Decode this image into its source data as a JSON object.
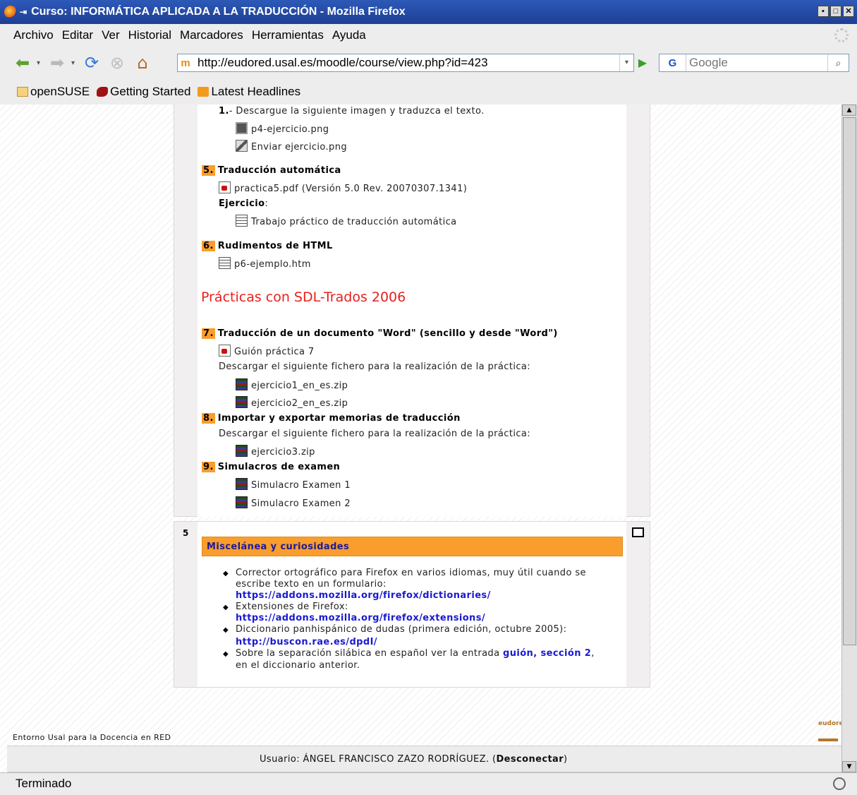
{
  "window": {
    "title": "Curso: INFORMÁTICA APLICADA A LA TRADUCCIÓN - Mozilla Firefox",
    "pin_glyph": "⇥",
    "buttons": [
      "▪",
      "□",
      "✕"
    ]
  },
  "menu": [
    "Archivo",
    "Editar",
    "Ver",
    "Historial",
    "Marcadores",
    "Herramientas",
    "Ayuda"
  ],
  "navigation": {
    "url": "http://eudored.usal.es/moodle/course/view.php?id=423",
    "search_placeholder": "Google",
    "search_engine_glyph": "G"
  },
  "bookmarks": [
    "openSUSE",
    "Getting Started",
    "Latest Headlines"
  ],
  "course": {
    "top_items": {
      "step1_num": "1.",
      "step1_text": "- Descargue la siguiente imagen y traduzca el texto.",
      "file_img": "p4-ejercicio.png",
      "file_send": "Enviar ejercicio.png"
    },
    "topic5": {
      "num": "5.",
      "title": "Traducción automática",
      "pdf": "practica5.pdf (Versión 5.0 Rev. 20070307.1341)",
      "exercise_label": "Ejercicio",
      "exercise_colon": ":",
      "exercise_doc": "Trabajo práctico de traducción automática"
    },
    "topic6": {
      "num": "6.",
      "title": "Rudimentos de HTML",
      "file": "p6-ejemplo.htm"
    },
    "trados_heading": "Prácticas con SDL-Trados 2006",
    "topic7": {
      "num": "7.",
      "title": "Traducción de un documento \"Word\" (sencillo y desde \"Word\")",
      "guide": "Guión práctica 7",
      "download_note": "Descargar el siguiente fichero para la realización de la práctica:",
      "zip1": "ejercicio1_en_es.zip",
      "zip2": "ejercicio2_en_es.zip"
    },
    "topic8": {
      "num": "8.",
      "title": "Importar y exportar memorias de traducción",
      "download_note": "Descargar el siguiente fichero para la realización de la práctica:",
      "zip": "ejercicio3.zip"
    },
    "topic9": {
      "num": "9.",
      "title": "Simulacros de examen",
      "sim1": "Simulacro Examen 1",
      "sim2": "Simulacro Examen 2"
    },
    "section5": {
      "number": "5",
      "heading": "Miscelánea y curiosidades",
      "b1_line1": "Corrector ortográfico para Firefox en varios idiomas, muy útil cuando se",
      "b1_line2": "escribe texto en un formulario:",
      "b1_link": "https://addons.mozilla.org/firefox/dictionaries/",
      "b2_line1": "Extensiones de Firefox:",
      "b2_link": "https://addons.mozilla.org/firefox/extensions/",
      "b3_line1": "Diccionario panhispánico de dudas (primera edición, octubre 2005):",
      "b3_link": "http://buscon.rae.es/dpdI/",
      "b4_pre": "Sobre la separación silábica en español ver la entrada ",
      "b4_link": "guión, sección 2",
      "b4_post": ",",
      "b4_line2": "en el diccionario anterior."
    }
  },
  "footer": {
    "left_text": "Entorno Usal para la Docencia en RED",
    "logo_text": "eudored",
    "user_label": "Usuario: ÁNGEL FRANCISCO ZAZO RODRÍGUEZ.",
    "logout_open": " (",
    "logout": "Desconectar",
    "logout_close": ")"
  },
  "status": {
    "text": "Terminado"
  }
}
